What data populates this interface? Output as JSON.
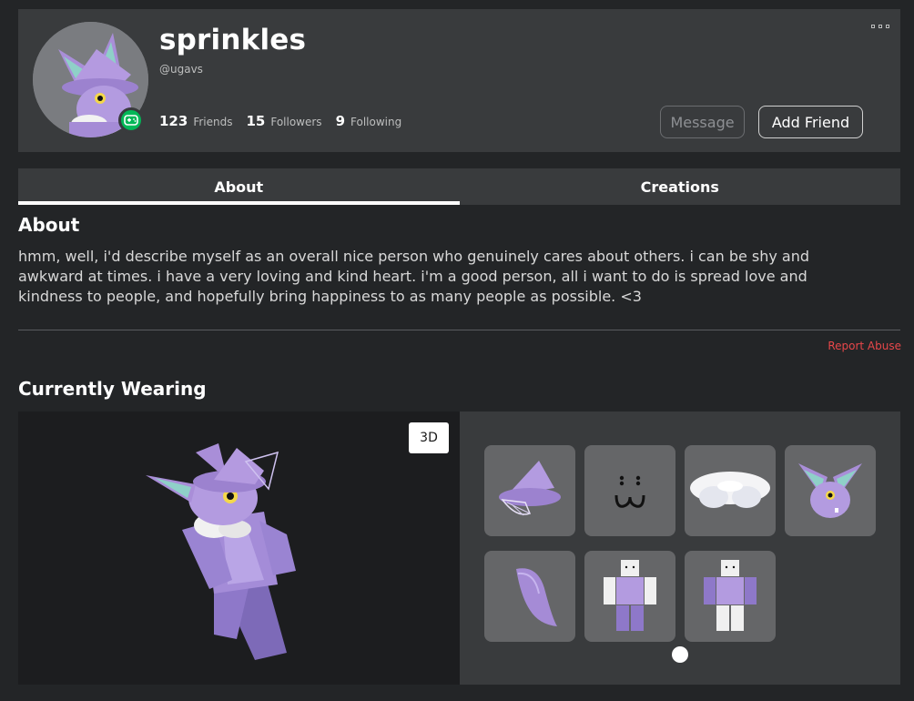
{
  "profile": {
    "display_name": "sprinkles",
    "username": "@ugavs",
    "stats": [
      {
        "value": "123",
        "label": "Friends"
      },
      {
        "value": "15",
        "label": "Followers"
      },
      {
        "value": "9",
        "label": "Following"
      }
    ],
    "presence": "in-game",
    "presence_icon": "gamepad-icon"
  },
  "actions": {
    "message_label": "Message",
    "add_friend_label": "Add Friend",
    "more_icon": "more-dots-icon"
  },
  "tabs": [
    {
      "label": "About",
      "active": true
    },
    {
      "label": "Creations",
      "active": false
    }
  ],
  "about": {
    "title": "About",
    "text": "hmm, well, i'd describe myself as an overall nice person who genuinely cares about others. i can be shy and awkward at times. i have a very loving and kind heart. i'm a good person, all i want to do is spread love and kindness to people, and hopefully bring happiness to as many people as possible. <3",
    "report_label": "Report Abuse"
  },
  "wearing": {
    "title": "Currently Wearing",
    "viewer_toggle": "3D",
    "items": [
      {
        "icon": "witch-hat-icon"
      },
      {
        "icon": "face-icon",
        "face": ": :\nω"
      },
      {
        "icon": "fluffy-collar-icon"
      },
      {
        "icon": "bat-head-icon"
      },
      {
        "icon": "hair-icon"
      },
      {
        "icon": "shirt-avatar-icon"
      },
      {
        "icon": "pants-avatar-icon"
      }
    ],
    "page_count": 1
  },
  "colors": {
    "background": "#232527",
    "card": "#393b3d",
    "presence_green": "#02b757",
    "report_red": "#e8474a",
    "accent_purple": "#9b7fd4"
  }
}
